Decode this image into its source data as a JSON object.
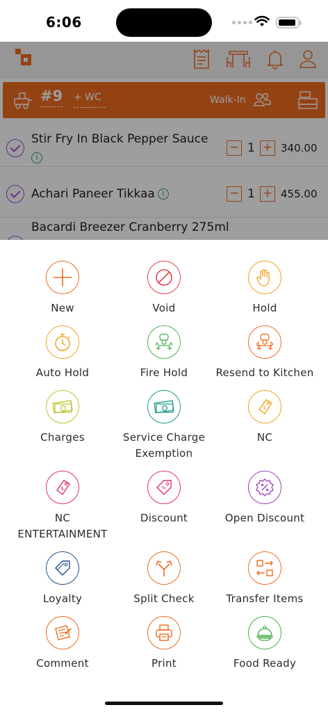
{
  "status_bar": {
    "time": "6:06"
  },
  "order": {
    "table": "#9",
    "guest_label": "+ WC",
    "mode": "Walk-In"
  },
  "items": [
    {
      "name": "Stir Fry In Black Pepper Sauce",
      "qty": "1",
      "price": "340.00"
    },
    {
      "name": "Achari Paneer Tikkaa",
      "qty": "1",
      "price": "455.00"
    },
    {
      "name": "Bacardi Breezer Cranberry 275ml",
      "qty": "",
      "price": ""
    }
  ],
  "actions": [
    {
      "label": "New",
      "icon": "plus-icon",
      "color": "#ee6b20"
    },
    {
      "label": "Void",
      "icon": "void-icon",
      "color": "#e0434d"
    },
    {
      "label": "Hold",
      "icon": "hand-icon",
      "color": "#f0a21d"
    },
    {
      "label": "Auto Hold",
      "icon": "stopwatch-icon",
      "color": "#f0a21d"
    },
    {
      "label": "Fire Hold",
      "icon": "chef-fire-icon",
      "color": "#4caf50"
    },
    {
      "label": "Resend to Kitchen",
      "icon": "chef-resend-icon",
      "color": "#ee6b20"
    },
    {
      "label": "Charges",
      "icon": "cash-icon",
      "color": "#b9c52d"
    },
    {
      "label": "Service Charge Exemption",
      "icon": "cash-exempt-icon",
      "color": "#1a9a8a"
    },
    {
      "label": "NC",
      "icon": "tag-icon",
      "color": "#f0a21d"
    },
    {
      "label": "NC ENTERTAINMENT",
      "icon": "tag-star-icon",
      "color": "#e0306a"
    },
    {
      "label": "Discount",
      "icon": "discount-tag-icon",
      "color": "#e0306a"
    },
    {
      "label": "Open Discount",
      "icon": "percent-badge-icon",
      "color": "#9b3fbf"
    },
    {
      "label": "Loyalty",
      "icon": "loyalty-tag-icon",
      "color": "#1f4e8c"
    },
    {
      "label": "Split Check",
      "icon": "split-icon",
      "color": "#ee6b20"
    },
    {
      "label": "Transfer Items",
      "icon": "transfer-icon",
      "color": "#ee6b20"
    },
    {
      "label": "Comment",
      "icon": "comment-note-icon",
      "color": "#ee6b20"
    },
    {
      "label": "Print",
      "icon": "printer-icon",
      "color": "#ee6b20"
    },
    {
      "label": "Food Ready",
      "icon": "cloche-icon",
      "color": "#4caf50"
    }
  ]
}
